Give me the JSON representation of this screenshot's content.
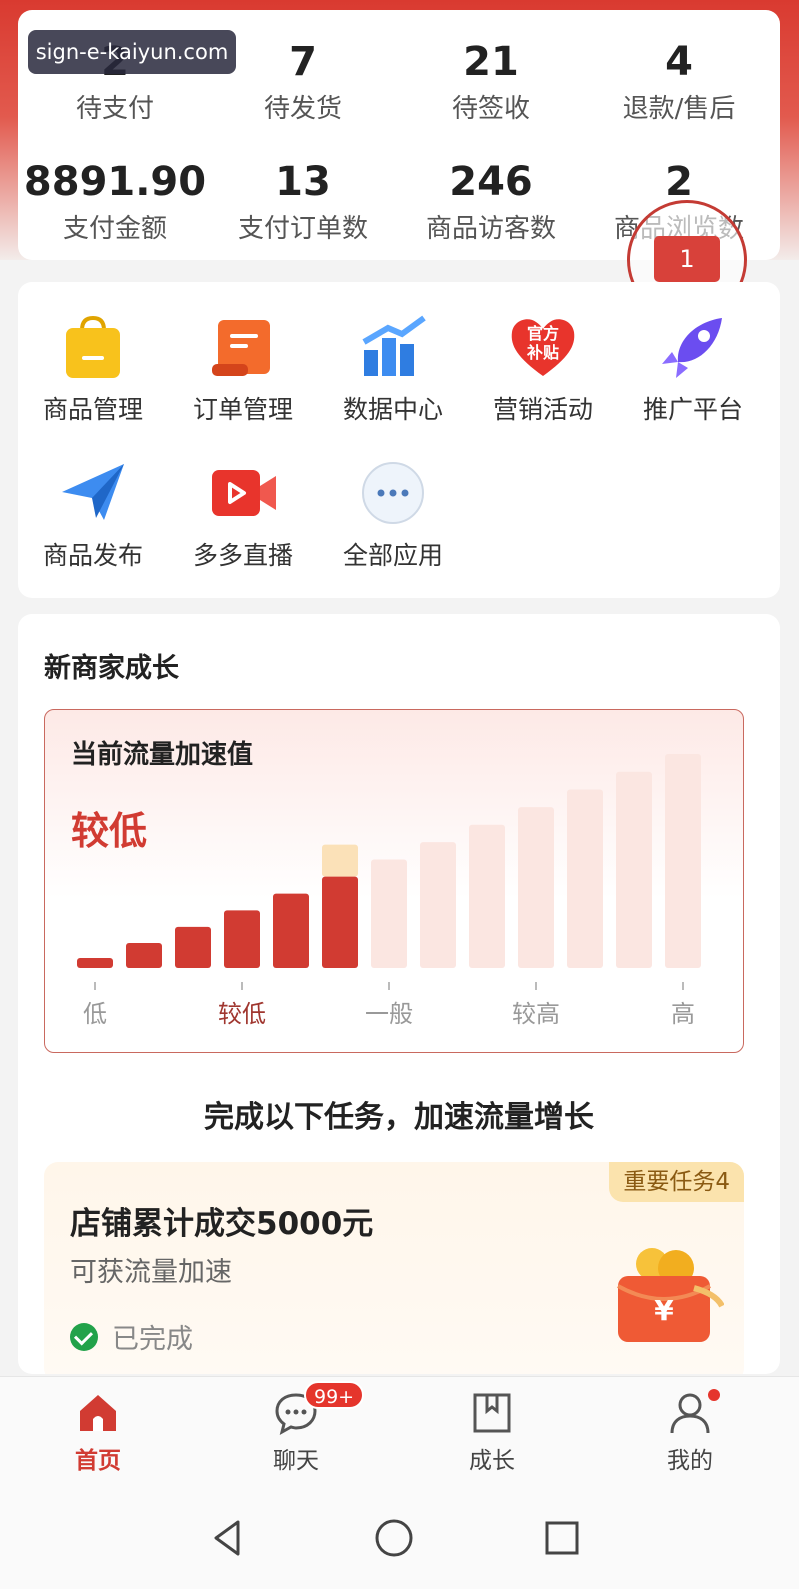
{
  "watermark": "sign-e-kaiyun.com",
  "stats": [
    {
      "num": "2",
      "label": "待支付"
    },
    {
      "num": "7",
      "label": "待发货"
    },
    {
      "num": "21",
      "label": "待签收"
    },
    {
      "num": "4",
      "label": "退款/售后"
    },
    {
      "num": "8891.90",
      "label": "支付金额"
    },
    {
      "num": "13",
      "label": "支付订单数"
    },
    {
      "num": "246",
      "label": "商品访客数"
    },
    {
      "num": "2",
      "label": "商品浏览数"
    }
  ],
  "message_badge": "1",
  "apps": [
    {
      "label": "商品管理",
      "icon": "shopping-bag-icon"
    },
    {
      "label": "订单管理",
      "icon": "order-scroll-icon"
    },
    {
      "label": "数据中心",
      "icon": "data-chart-icon"
    },
    {
      "label": "营销活动",
      "icon": "subsidy-heart-icon",
      "icon_text": "官方补贴"
    },
    {
      "label": "推广平台",
      "icon": "rocket-icon"
    },
    {
      "label": "商品发布",
      "icon": "paper-plane-icon"
    },
    {
      "label": "多多直播",
      "icon": "live-video-icon"
    },
    {
      "label": "全部应用",
      "icon": "more-dots-icon"
    }
  ],
  "growth": {
    "title": "新商家成长",
    "speed_title": "当前流量加速值",
    "speed_level": "较低",
    "level": 6,
    "level_max": 13,
    "axis_labels": [
      "低",
      "较低",
      "一般",
      "较高",
      "高"
    ]
  },
  "tasks": {
    "header": "完成以下任务，加速流量增长",
    "card": {
      "badge": "重要任务4",
      "title": "店铺累计成交5000元",
      "subtitle": "可获流量加速",
      "status": "已完成",
      "reward_symbol": "¥"
    }
  },
  "tabbar": [
    {
      "label": "首页",
      "icon": "home-icon",
      "active": true
    },
    {
      "label": "聊天",
      "icon": "chat-icon",
      "badge": "99+"
    },
    {
      "label": "成长",
      "icon": "growth-book-icon"
    },
    {
      "label": "我的",
      "icon": "profile-icon",
      "dot": true
    }
  ],
  "colors": {
    "brand_red": "#d13b32",
    "bar_inactive": "#fbe6e1"
  }
}
